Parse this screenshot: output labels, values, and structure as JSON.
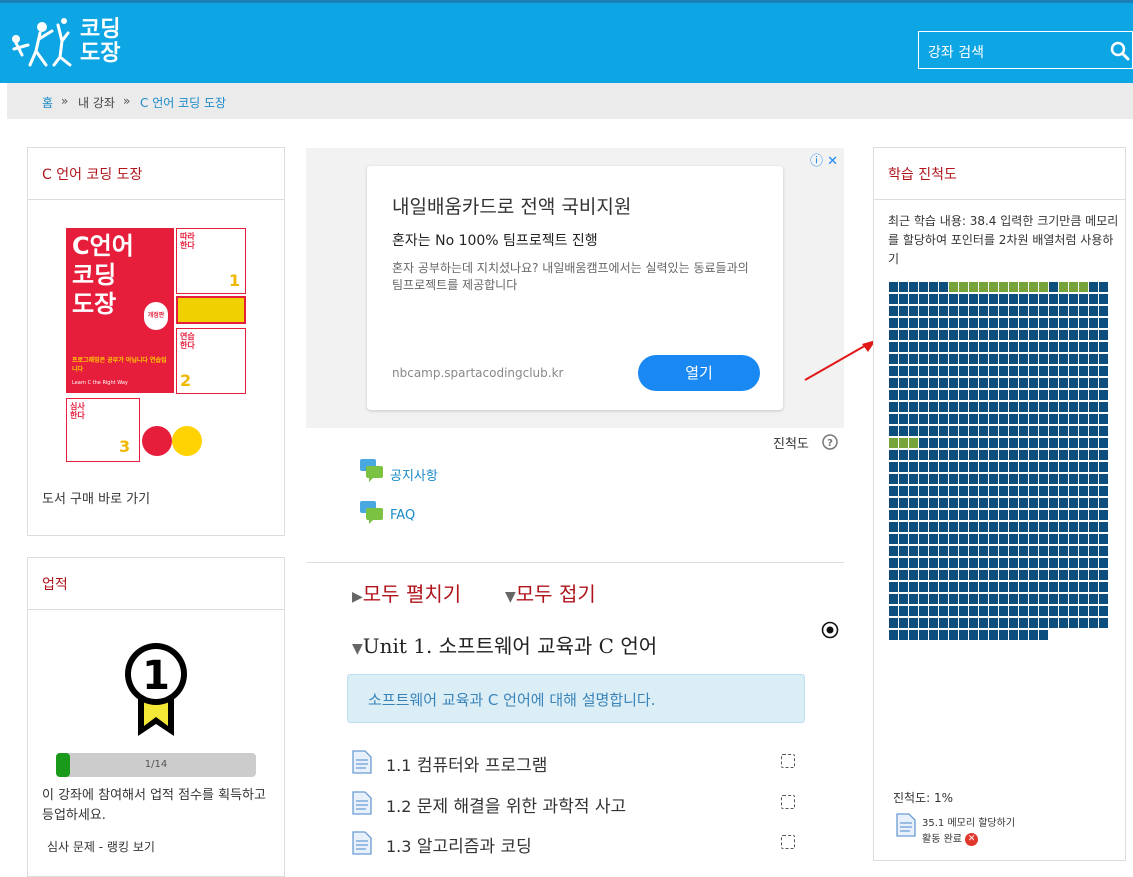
{
  "header": {
    "logo_line1": "코딩",
    "logo_line2": "도장",
    "search_placeholder": "강좌 검색"
  },
  "breadcrumb": [
    "홈",
    "»",
    "내 강좌",
    "»",
    "C 언어 코딩 도장"
  ],
  "book_panel": {
    "title": "C 언어 코딩 도장",
    "book_cover": {
      "title_lines": [
        "C언어",
        "코딩",
        "도장"
      ],
      "badge": "개정판",
      "tagline": "프로그래밍은 공부가 아닙니다 연습입니다",
      "author": "Learn C the Right Way",
      "steps": [
        "따라 한다",
        "연습 한다",
        "심사 한다"
      ],
      "step_numbers": [
        "1",
        "2",
        "3"
      ]
    },
    "buy_link": "도서 구매 바로 가기"
  },
  "achievement_panel": {
    "title": "업적",
    "progress_label": "1/14",
    "progress_fraction": 0.0714,
    "description": "이 강좌에 참여해서 업적 점수를 획득하고 등업하세요.",
    "ranking_link": "심사 문제 - 랭킹 보기"
  },
  "ad": {
    "title": "내일배움카드로 전액 국비지원",
    "subtitle": "혼자는 No 100% 팀프로젝트 진행",
    "body": "혼자 공부하는데 지치셨나요? 내일배움캠프에서는 실력있는 동료들과의 팀프로젝트를 제공합니다",
    "url": "nbcamp.spartacodingclub.kr",
    "button": "열기"
  },
  "progress_help": "진척도",
  "links": [
    "공지사항",
    "FAQ"
  ],
  "controls": {
    "expand_all": "모두 펼치기",
    "collapse_all": "모두 접기"
  },
  "unit": {
    "title": "Unit 1. 소프트웨어 교육과 C 언어",
    "summary": "소프트웨어 교육과 C 언어에 대해 설명합니다.",
    "items": [
      {
        "num": "1.1",
        "title": "컴퓨터와 프로그램"
      },
      {
        "num": "1.2",
        "title": "문제 해결을 위한 과학적 사고"
      },
      {
        "num": "1.3",
        "title": "알고리즘과 코딩"
      }
    ]
  },
  "learning_panel": {
    "title": "학습 진척도",
    "recent": "최근 학습 내용: 38.4 입력한 크기만큼 메모리를 할당하여 포인터를 2차원 배열처럼 사용하기",
    "progress_text": "진척도: 1%",
    "activity_title": "35.1 메모리 할당하기",
    "activity_status": "활동 완료"
  },
  "grid": {
    "columns": 22,
    "total_cells": 654,
    "completed_cells": [
      6,
      7,
      8,
      9,
      10,
      11,
      12,
      13,
      14,
      15,
      17,
      18,
      19,
      286,
      287,
      288
    ],
    "color_done": "#76a33a",
    "color_todo": "#0c4f7e"
  }
}
